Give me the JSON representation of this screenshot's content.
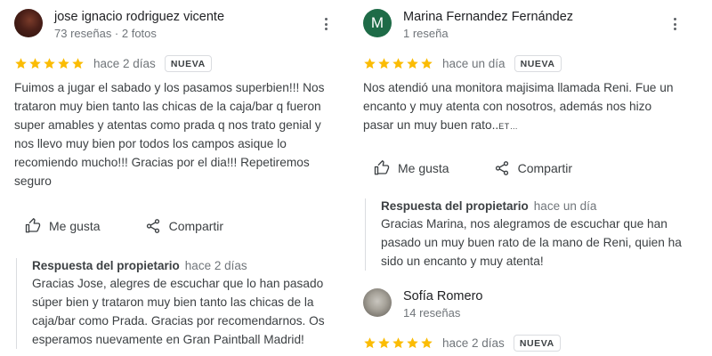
{
  "colors": {
    "star": "#fbbc04",
    "avatar_m": "#1e6b47",
    "secondary_text": "#70757a"
  },
  "reviews": [
    {
      "author": "jose ignacio rodriguez vicente",
      "meta": "73 reseñas · 2 fotos",
      "rating": 5,
      "date": "hace 2 días",
      "badge": "NUEVA",
      "text": "Fuimos a jugar el sabado y los pasamos superbien!!! Nos trataron muy bien tanto las chicas de la caja/bar q fueron super amables y atentas como prada q nos trato genial y nos llevo muy bien por todos los campos asique lo recomiendo mucho!!! Gracias por el dia!!! Repetiremos seguro",
      "like_label": "Me gusta",
      "share_label": "Compartir",
      "reply": {
        "title": "Respuesta del propietario",
        "date": "hace 2 días",
        "text": "Gracias Jose, alegres de escuchar que lo han pasado súper bien y trataron muy bien tanto las chicas de la caja/bar como Prada. Gracias por recomendarnos. Os esperamos nuevamente en Gran Paintball Madrid!"
      }
    },
    {
      "author": "Marina Fernandez Fernández",
      "avatar_letter": "M",
      "meta": "1 reseña",
      "rating": 5,
      "date": "hace un día",
      "badge": "NUEVA",
      "text": "Nos atendió una monitora majisima llamada Reni. Fue un encanto y muy atenta con nosotros, además nos hizo pasar un muy buen rato..",
      "more_label": "ET…",
      "like_label": "Me gusta",
      "share_label": "Compartir",
      "reply": {
        "title": "Respuesta del propietario",
        "date": "hace un día",
        "text": "Gracias Marina, nos alegramos de escuchar que han pasado un muy buen rato de la mano de Reni, quien ha sido un encanto y muy atenta!"
      }
    },
    {
      "author": "Sofía Romero",
      "meta": "14 reseñas",
      "rating": 5,
      "date": "hace 2 días",
      "badge": "NUEVA"
    }
  ]
}
